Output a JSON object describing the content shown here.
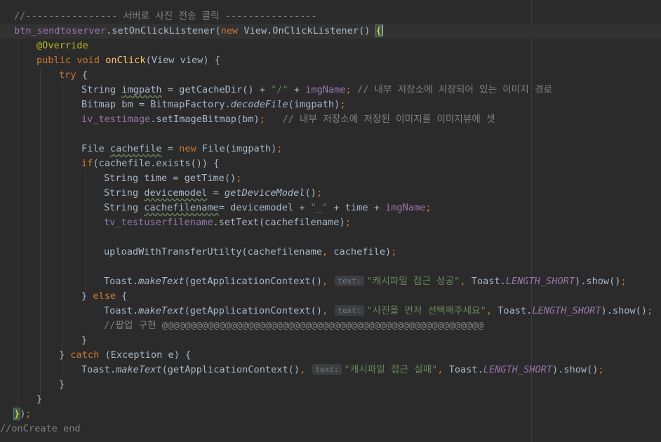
{
  "editor": {
    "lines": [
      "//---------------- 서버로 사진 전송 클릭 ----------------",
      "btn_sendtoserver.setOnClickListener(new View.OnClickListener() {",
      "@Override",
      "public void onClick(View view) {",
      "try {",
      "String imgpath = getCacheDir() + \"/\" + imgName; // 내부 저장소에 저장되어 있는 이미지 경로",
      "Bitmap bm = BitmapFactory.decodeFile(imgpath);",
      "iv_testimage.setImageBitmap(bm);   // 내부 저장소에 저장된 이미지를 이미지뷰에 셋",
      "",
      "File cachefile = new File(imgpath);",
      "if(cachefile.exists()) {",
      "String time = getTime();",
      "String devicemodel = getDeviceModel();",
      "String cachefilename= devicemodel + \"_\" + time + imgName;",
      "tv_testuserfilename.setText(cachefilename);",
      "",
      "uploadWithTransferUtilty(cachefilename, cachefile);",
      "",
      "Toast.makeText(getApplicationContext(), text: \"캐시파일 접근 성공\", Toast.LENGTH_SHORT).show();",
      "} else {",
      "Toast.makeText(getApplicationContext(), text: \"사진을 먼저 선택해주세요\", Toast.LENGTH_SHORT).show();",
      "//팝업 구현 @@@@@@@@@@@@@@@@@@@@@@@@@@@@@@@@@@@@@@@@@@@@@@@@@@@@@@@@",
      "}",
      "} catch (Exception e) {",
      "Toast.makeText(getApplicationContext(), text: \"캐시파일 접근 실패\", Toast.LENGTH_SHORT).show();",
      "}",
      "}",
      "});",
      "//onCreate end"
    ]
  },
  "colors": {
    "background": "#2b2b2b",
    "default_text": "#a9b7c6",
    "keyword": "#cc7832",
    "comment": "#808080",
    "string": "#6a8759",
    "field": "#9876aa",
    "method_declaration": "#ffc66d",
    "annotation": "#bbb529",
    "brace_match": "#ffef28"
  }
}
